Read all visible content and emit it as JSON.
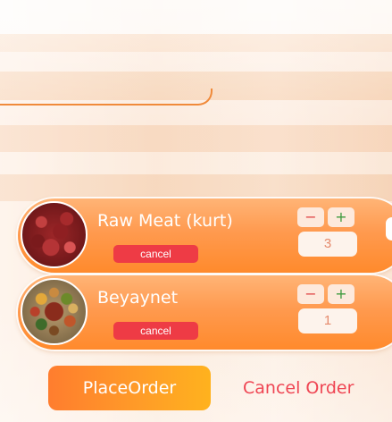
{
  "cart": {
    "items": [
      {
        "name": "Raw Meat (kurt)",
        "cancel_label": "cancel",
        "minus_label": "−",
        "plus_label": "+",
        "quantity": "3",
        "image": "raw-meat-photo"
      },
      {
        "name": "Beyaynet",
        "cancel_label": "cancel",
        "minus_label": "−",
        "plus_label": "+",
        "quantity": "1",
        "image": "beyaynet-photo"
      }
    ]
  },
  "actions": {
    "place_order_label": "PlaceOrder",
    "cancel_order_label": "Cancel Order"
  },
  "colors": {
    "accent_orange": "#ff8a2c",
    "cancel_red": "#ee3b45",
    "cancel_order_text": "#ef4553",
    "plus_green": "#3e9a3e"
  }
}
